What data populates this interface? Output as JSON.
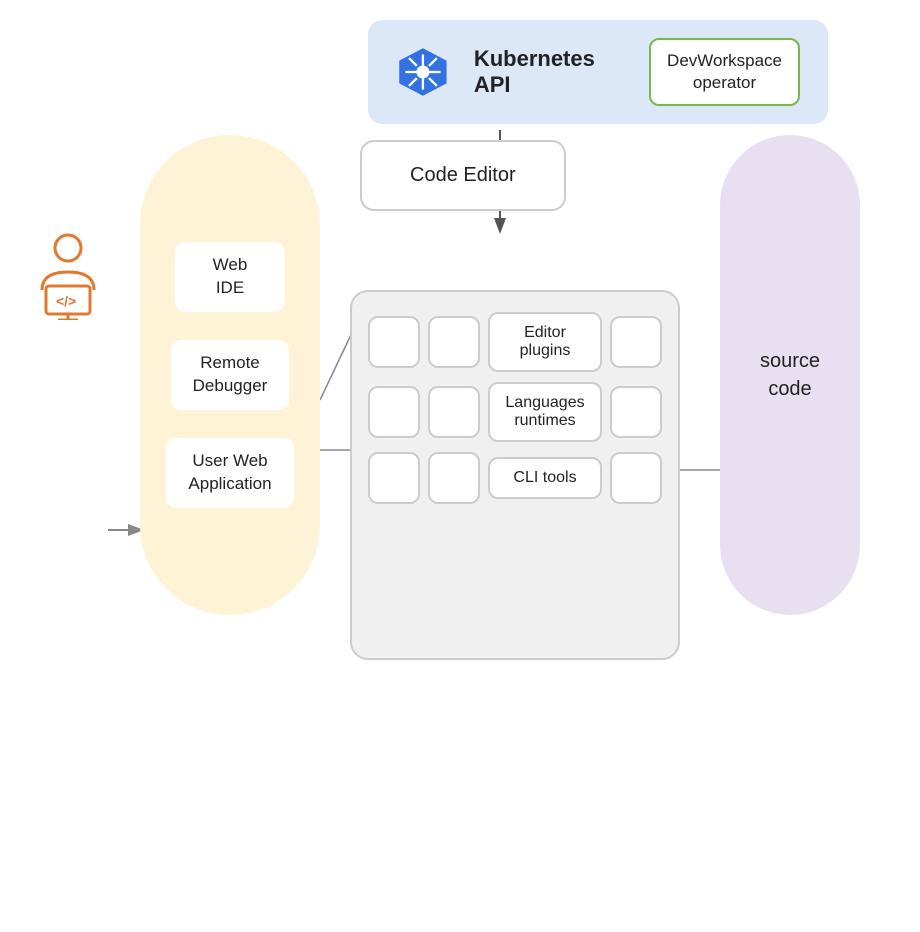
{
  "top": {
    "k8s_label": "Kubernetes API",
    "devworkspace_label": "DevWorkspace\noperator"
  },
  "yellow_pill": {
    "items": [
      {
        "id": "web-ide",
        "label": "Web\nIDE"
      },
      {
        "id": "remote-debugger",
        "label": "Remote\nDebugger"
      },
      {
        "id": "user-web-app",
        "label": "User Web\nApplication"
      }
    ]
  },
  "code_editor": {
    "label": "Code Editor"
  },
  "plugins_container": {
    "rows": [
      {
        "id": "editor-plugins",
        "label": "Editor plugins"
      },
      {
        "id": "languages-runtimes",
        "label": "Languages runtimes"
      },
      {
        "id": "cli-tools",
        "label": "CLI tools"
      }
    ]
  },
  "source_code": {
    "label": "source\ncode"
  }
}
